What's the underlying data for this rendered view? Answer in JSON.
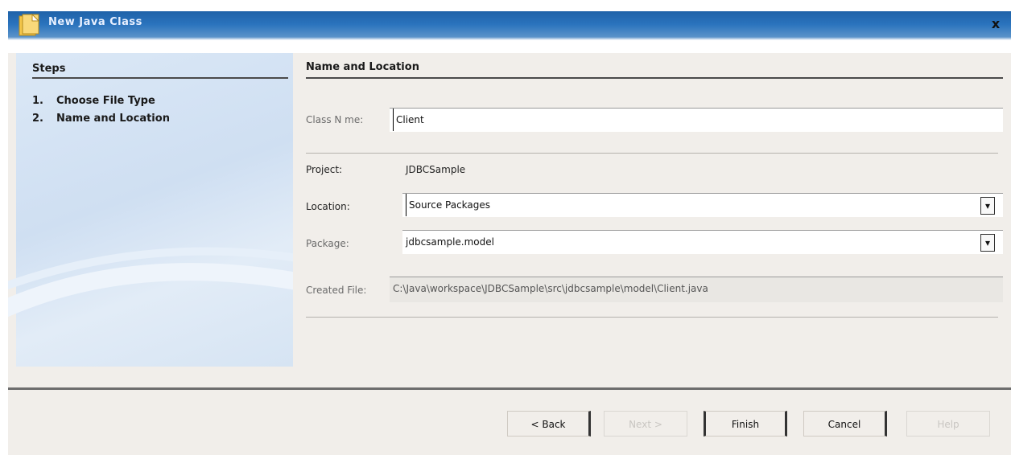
{
  "window": {
    "title": "New Java Class",
    "close_glyph": "x",
    "icon": "new-file-icon"
  },
  "steps": {
    "title": "Steps",
    "items": [
      {
        "num": "1.",
        "label": "Choose File Type"
      },
      {
        "num": "2.",
        "label": "Name and Location"
      }
    ]
  },
  "form": {
    "section_title": "Name and Location",
    "class_name": {
      "label": "Class N me:",
      "value": "Client"
    },
    "project": {
      "label": "Project:",
      "value": "JDBCSample"
    },
    "location": {
      "label": "Location:",
      "value": "Source Packages"
    },
    "package": {
      "label": "Package:",
      "value": "jdbcsample.model"
    },
    "created_file": {
      "label": "Created File:",
      "value": "C:\\Java\\workspace\\JDBCSample\\src\\jdbcsample\\model\\Client.java"
    }
  },
  "buttons": {
    "back": "< Back",
    "next": "Next >",
    "finish": "Finish",
    "cancel": "Cancel",
    "help": "Help"
  },
  "dropdown_glyph": "▾"
}
